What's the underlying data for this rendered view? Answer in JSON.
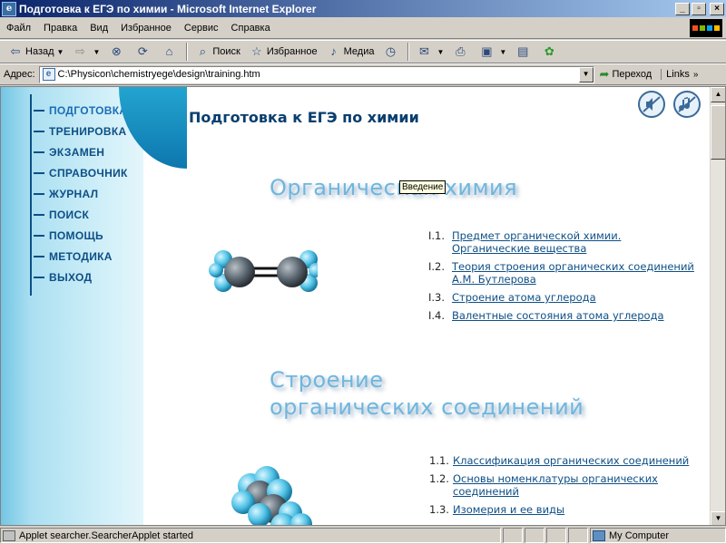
{
  "window": {
    "title": "Подготовка к ЕГЭ по химии - Microsoft Internet Explorer",
    "buttons": [
      "_",
      "▫",
      "×"
    ]
  },
  "menubar": {
    "items": [
      "Файл",
      "Правка",
      "Вид",
      "Избранное",
      "Сервис",
      "Справка"
    ]
  },
  "toolbar": {
    "back_label": "Назад",
    "search_label": "Поиск",
    "favorites_label": "Избранное",
    "media_label": "Медиа"
  },
  "address": {
    "label": "Адрес:",
    "url": "C:\\Physicon\\chemistryege\\design\\training.htm",
    "go_label": "Переход",
    "links_label": "Links"
  },
  "sidebar": {
    "items": [
      {
        "label": "ПОДГОТОВКА",
        "active": true
      },
      {
        "label": "ТРЕНИРОВКА",
        "active": false
      },
      {
        "label": "ЭКЗАМЕН",
        "active": false
      },
      {
        "label": "СПРАВОЧНИК",
        "active": false
      },
      {
        "label": "ЖУРНАЛ",
        "active": false
      },
      {
        "label": "ПОИСК",
        "active": false
      },
      {
        "label": "ПОМОЩЬ",
        "active": false
      },
      {
        "label": "МЕТОДИКА",
        "active": false
      },
      {
        "label": "ВЫХОД",
        "active": false
      }
    ]
  },
  "main": {
    "page_title": "Подготовка к ЕГЭ по химии",
    "tooltip": "Введение",
    "sections": [
      {
        "heading_lines": [
          "Органическая химия"
        ],
        "items": [
          {
            "num": "I.1.",
            "text": "Предмет органической химии. Органические вещества"
          },
          {
            "num": "I.2.",
            "text": "Теория строения органических соединений А.М. Бутлерова"
          },
          {
            "num": "I.3.",
            "text": "Строение атома углерода"
          },
          {
            "num": "I.4.",
            "text": "Валентные состояния атома углерода"
          }
        ]
      },
      {
        "heading_lines": [
          "Строение",
          "органических соединений"
        ],
        "items": [
          {
            "num": "1.1.",
            "text": "Классификация органических соединений"
          },
          {
            "num": "1.2.",
            "text": "Основы номенклатуры органических соединений"
          },
          {
            "num": "1.3.",
            "text": "Изомерия и ее виды"
          }
        ]
      }
    ]
  },
  "status": {
    "text": "Applet searcher.SearcherApplet started",
    "zone": "My Computer"
  },
  "colors": {
    "title_bar": "#0a246a",
    "nav_text": "#0e4f86",
    "heading": "#6fb6dd",
    "link": "#0e4f86"
  },
  "icons": {
    "sound_off": "speaker-muted-icon",
    "music_off": "music-muted-icon"
  }
}
